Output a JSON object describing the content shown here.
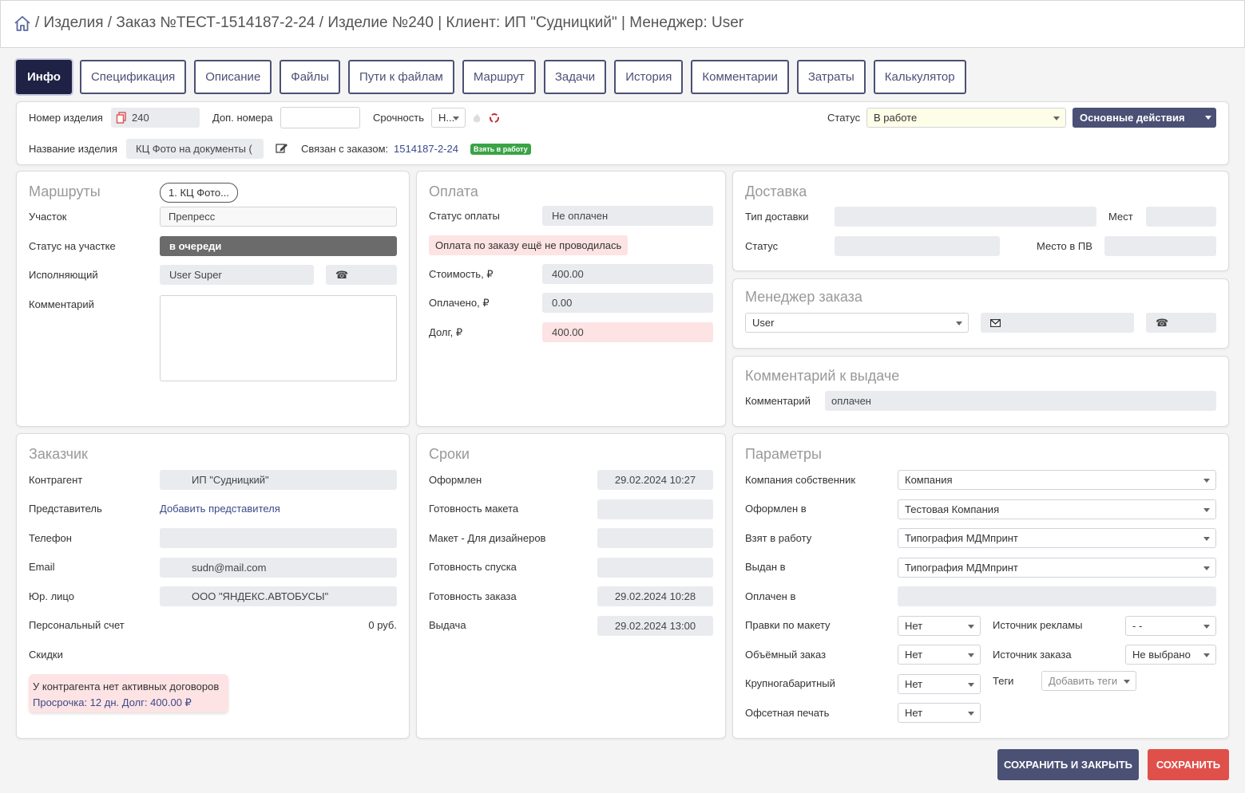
{
  "breadcrumb": {
    "text": "/ Изделия / Заказ №ТЕСТ-1514187-2-24 / Изделие №240 | Клиент: ИП \"Судницкий\" | Менеджер: User"
  },
  "tabs": [
    "Инфо",
    "Спецификация",
    "Описание",
    "Файлы",
    "Пути к файлам",
    "Маршрут",
    "Задачи",
    "История",
    "Комментарии",
    "Затраты",
    "Калькулятор"
  ],
  "top": {
    "item_number_label": "Номер изделия",
    "item_number": "240",
    "extra_numbers_label": "Доп. номера",
    "urgency_label": "Срочность",
    "urgency_value": "Н...",
    "status_label": "Статус",
    "status_value": "В работе",
    "main_actions": "Основные действия",
    "item_name_label": "Название изделия",
    "item_name": "КЦ Фото на документы (",
    "linked_label": "Связан с заказом:",
    "linked_order": "1514187-2-24",
    "take_badge": "Взять в работу"
  },
  "routes": {
    "title": "Маршруты",
    "route_chip": "1. КЦ Фото...",
    "section_label": "Участок",
    "section_value": "Препресс",
    "section_status_label": "Статус на участке",
    "section_status_value": "в очереди",
    "executor_label": "Исполняющий",
    "executor_value": "User Super",
    "comment_label": "Комментарий"
  },
  "payment": {
    "title": "Оплата",
    "status_label": "Статус оплаты",
    "status_value": "Не оплачен",
    "alert": "Оплата по заказу ещё не проводилась",
    "cost_label": "Стоимость, ₽",
    "cost": "400.00",
    "paid_label": "Оплачено, ₽",
    "paid": "0.00",
    "debt_label": "Долг, ₽",
    "debt": "400.00"
  },
  "delivery": {
    "title": "Доставка",
    "type_label": "Тип доставки",
    "places_label": "Мест",
    "status_label": "Статус",
    "pv_label": "Место в ПВ"
  },
  "manager": {
    "title": "Менеджер заказа",
    "value": "User"
  },
  "issue_comment": {
    "title": "Комментарий к выдаче",
    "label": "Комментарий",
    "value": "оплачен"
  },
  "customer": {
    "title": "Заказчик",
    "contractor_label": "Контрагент",
    "contractor": "ИП \"Судницкий\"",
    "rep_label": "Представитель",
    "rep_link": "Добавить представителя",
    "phone_label": "Телефон",
    "email_label": "Email",
    "email": "sudn@mail.com",
    "legal_label": "Юр. лицо",
    "legal": "ООО \"ЯНДЕКС.АВТОБУСЫ\"",
    "account_label": "Персональный счет",
    "account": "0 руб.",
    "discounts_label": "Скидки",
    "warn1": "У контрагента нет активных договоров",
    "warn2": "Просрочка: 12 дн. Долг: 400.00 ₽"
  },
  "terms": {
    "title": "Сроки",
    "rows": [
      {
        "label": "Оформлен",
        "value": "29.02.2024 10:27"
      },
      {
        "label": "Готовность макета",
        "value": ""
      },
      {
        "label": "Макет - Для дизайнеров",
        "value": ""
      },
      {
        "label": "Готовность спуска",
        "value": ""
      },
      {
        "label": "Готовность заказа",
        "value": "29.02.2024 10:28"
      },
      {
        "label": "Выдача",
        "value": "29.02.2024 13:00"
      }
    ]
  },
  "params": {
    "title": "Параметры",
    "owner_label": "Компания собственник",
    "owner": "Компания",
    "made_in_label": "Оформлен в",
    "made_in": "Тестовая Компания",
    "taken_label": "Взят в работу",
    "taken": "Типография МДМпринт",
    "issued_label": "Выдан в",
    "issued": "Типография МДМпринт",
    "paid_in_label": "Оплачен в",
    "edits_label": "Правки по макету",
    "edits": "Нет",
    "ad_label": "Источник рекламы",
    "ad": "- -",
    "bulk_label": "Объёмный заказ",
    "bulk": "Нет",
    "src_label": "Источник заказа",
    "src": "Не выбрано",
    "large_label": "Крупногабаритный",
    "large": "Нет",
    "tags_label": "Теги",
    "tags": "Добавить теги",
    "offset_label": "Офсетная печать",
    "offset": "Нет"
  },
  "buttons": {
    "save_close": "СОХРАНИТЬ И ЗАКРЫТЬ",
    "save": "СОХРАНИТЬ"
  },
  "colors": {
    "dark": "#1f2244",
    "accent": "#4b5075",
    "save": "#e0504a",
    "debt_bg": "#fde3e3",
    "badge": "#3aa345"
  }
}
